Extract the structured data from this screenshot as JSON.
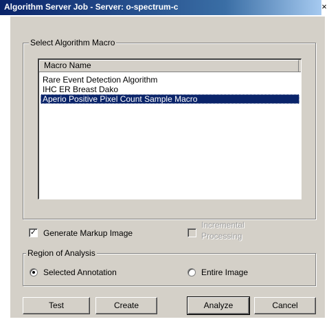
{
  "window": {
    "title": "Algorithm Server Job - Server: o-spectrum-c",
    "close_glyph": "×"
  },
  "macro_group": {
    "legend": "Select Algorithm Macro",
    "column_header": "Macro Name",
    "items": [
      {
        "label": "Rare Event Detection Algorithm",
        "selected": false
      },
      {
        "label": "IHC ER Breast Dako",
        "selected": false
      },
      {
        "label": "Aperio Positive Pixel Count Sample Macro",
        "selected": true
      }
    ]
  },
  "options": {
    "generate_markup": {
      "label": "Generate Markup Image",
      "checked": true,
      "check_glyph": "✓"
    },
    "incremental": {
      "label_line1": "Incremental",
      "label_line2": "Processing",
      "checked": false,
      "enabled": false
    }
  },
  "region_group": {
    "legend": "Region of Analysis",
    "selected_annotation": {
      "label": "Selected Annotation",
      "selected": true
    },
    "entire_image": {
      "label": "Entire Image",
      "selected": false
    }
  },
  "buttons": {
    "test": "Test",
    "create": "Create",
    "analyze": "Analyze",
    "cancel": "Cancel"
  },
  "colors": {
    "title_bar": "#0a246a",
    "selection": "#0a246a",
    "face": "#d4d0c8"
  }
}
